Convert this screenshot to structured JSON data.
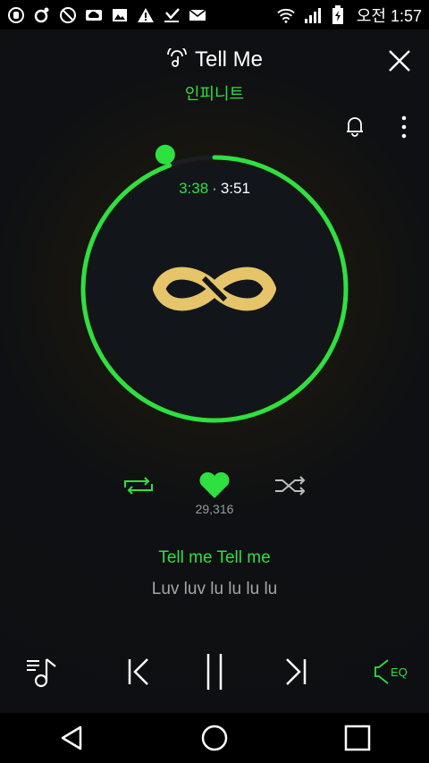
{
  "status_bar": {
    "time": "오전 1:57",
    "left_icons": [
      "app-icon",
      "music-icon",
      "block-icon",
      "cloud-icon",
      "image-icon",
      "warning-icon",
      "download-icon",
      "mail-icon"
    ],
    "right_icons": [
      "wifi-icon",
      "signal-icon",
      "battery-icon"
    ]
  },
  "header": {
    "song_title": "Tell Me",
    "artist": "인피니트"
  },
  "progress": {
    "current": "3:38",
    "separator": "·",
    "total": "3:51",
    "fraction": 0.944
  },
  "controls": {
    "like_count": "29,316"
  },
  "lyrics": {
    "current_line": "Tell me Tell me",
    "next_line": "Luv luv lu lu lu lu"
  },
  "bottom_controls": {
    "eq_label": "EQ"
  },
  "colors": {
    "accent": "#2ee040",
    "logo_gold": "#e6c46a",
    "background": "#0d0f12"
  }
}
